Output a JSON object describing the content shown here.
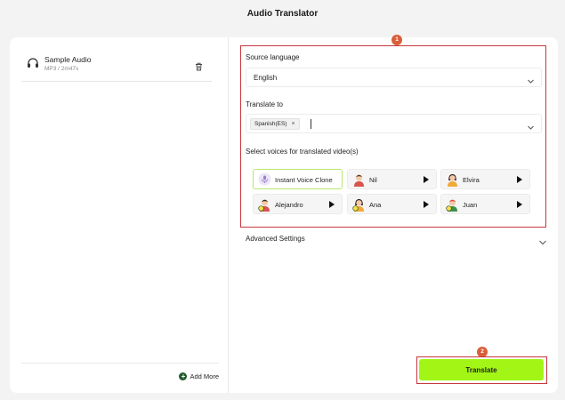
{
  "app": {
    "title": "Audio Translator"
  },
  "file": {
    "name": "Sample Audio",
    "meta": "MP3 / 2m47s"
  },
  "left_footer": {
    "add_more_label": "Add More"
  },
  "source": {
    "label": "Source language",
    "value": "English"
  },
  "target": {
    "label": "Translate to",
    "chips": [
      "Spanish(ES)"
    ],
    "chip_remove": "×"
  },
  "voices": {
    "label": "Select voices for translated video(s)",
    "items": [
      {
        "name": "Instant Voice Clone",
        "selected": true
      },
      {
        "name": "Nil"
      },
      {
        "name": "Elvira"
      },
      {
        "name": "Alejandro"
      },
      {
        "name": "Ana"
      },
      {
        "name": "Juan"
      }
    ]
  },
  "advanced": {
    "label": "Advanced Settings"
  },
  "translate": {
    "label": "Translate"
  },
  "badges": {
    "first": "1",
    "second": "2"
  },
  "colors": {
    "accent": "#a3f515",
    "highlight": "#c7373c",
    "badge": "#d95f3a"
  }
}
